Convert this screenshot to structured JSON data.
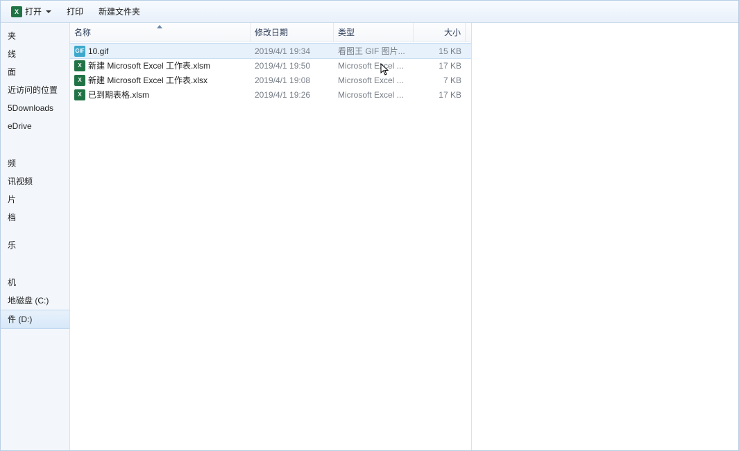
{
  "toolbar": {
    "open_label": "打开",
    "print_label": "打印",
    "new_folder_label": "新建文件夹"
  },
  "columns": {
    "name": "名称",
    "modified": "修改日期",
    "type": "类型",
    "size": "大小"
  },
  "sidebar": {
    "items": [
      "夹",
      "线",
      "面",
      "近访问的位置",
      "5Downloads",
      "eDrive",
      "",
      "",
      "频",
      "讯视频",
      "片",
      "档",
      "",
      "乐",
      "",
      "",
      "机",
      "地磁盘 (C:)",
      "件 (D:)"
    ],
    "selected_index": 18
  },
  "files": [
    {
      "icon": "gif",
      "name": "10.gif",
      "modified": "2019/4/1 19:34",
      "type": "看图王 GIF 图片...",
      "size": "15 KB",
      "selected": true
    },
    {
      "icon": "xls",
      "name": "新建 Microsoft Excel 工作表.xlsm",
      "modified": "2019/4/1 19:50",
      "type": "Microsoft Excel ...",
      "size": "17 KB",
      "selected": false
    },
    {
      "icon": "xls",
      "name": "新建 Microsoft Excel 工作表.xlsx",
      "modified": "2019/4/1 19:08",
      "type": "Microsoft Excel ...",
      "size": "7 KB",
      "selected": false
    },
    {
      "icon": "xls",
      "name": "已到期表格.xlsm",
      "modified": "2019/4/1 19:26",
      "type": "Microsoft Excel ...",
      "size": "17 KB",
      "selected": false
    }
  ]
}
